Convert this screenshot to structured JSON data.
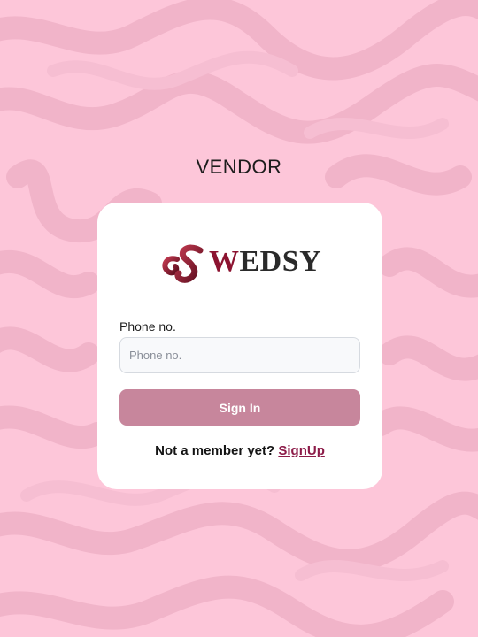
{
  "page": {
    "heading": "VENDOR"
  },
  "logo": {
    "text_w": "W",
    "text_rest": "EDSY"
  },
  "form": {
    "phone_label": "Phone no.",
    "phone_placeholder": "Phone no.",
    "phone_value": "",
    "signin_label": "Sign In"
  },
  "signup": {
    "prompt": "Not a member yet?",
    "link_label": "SignUp"
  },
  "colors": {
    "background": "#fdc6d9",
    "pattern": "#f1b5ca",
    "button": "#c7869c",
    "brand": "#8c1330",
    "link": "#8c1b48"
  }
}
